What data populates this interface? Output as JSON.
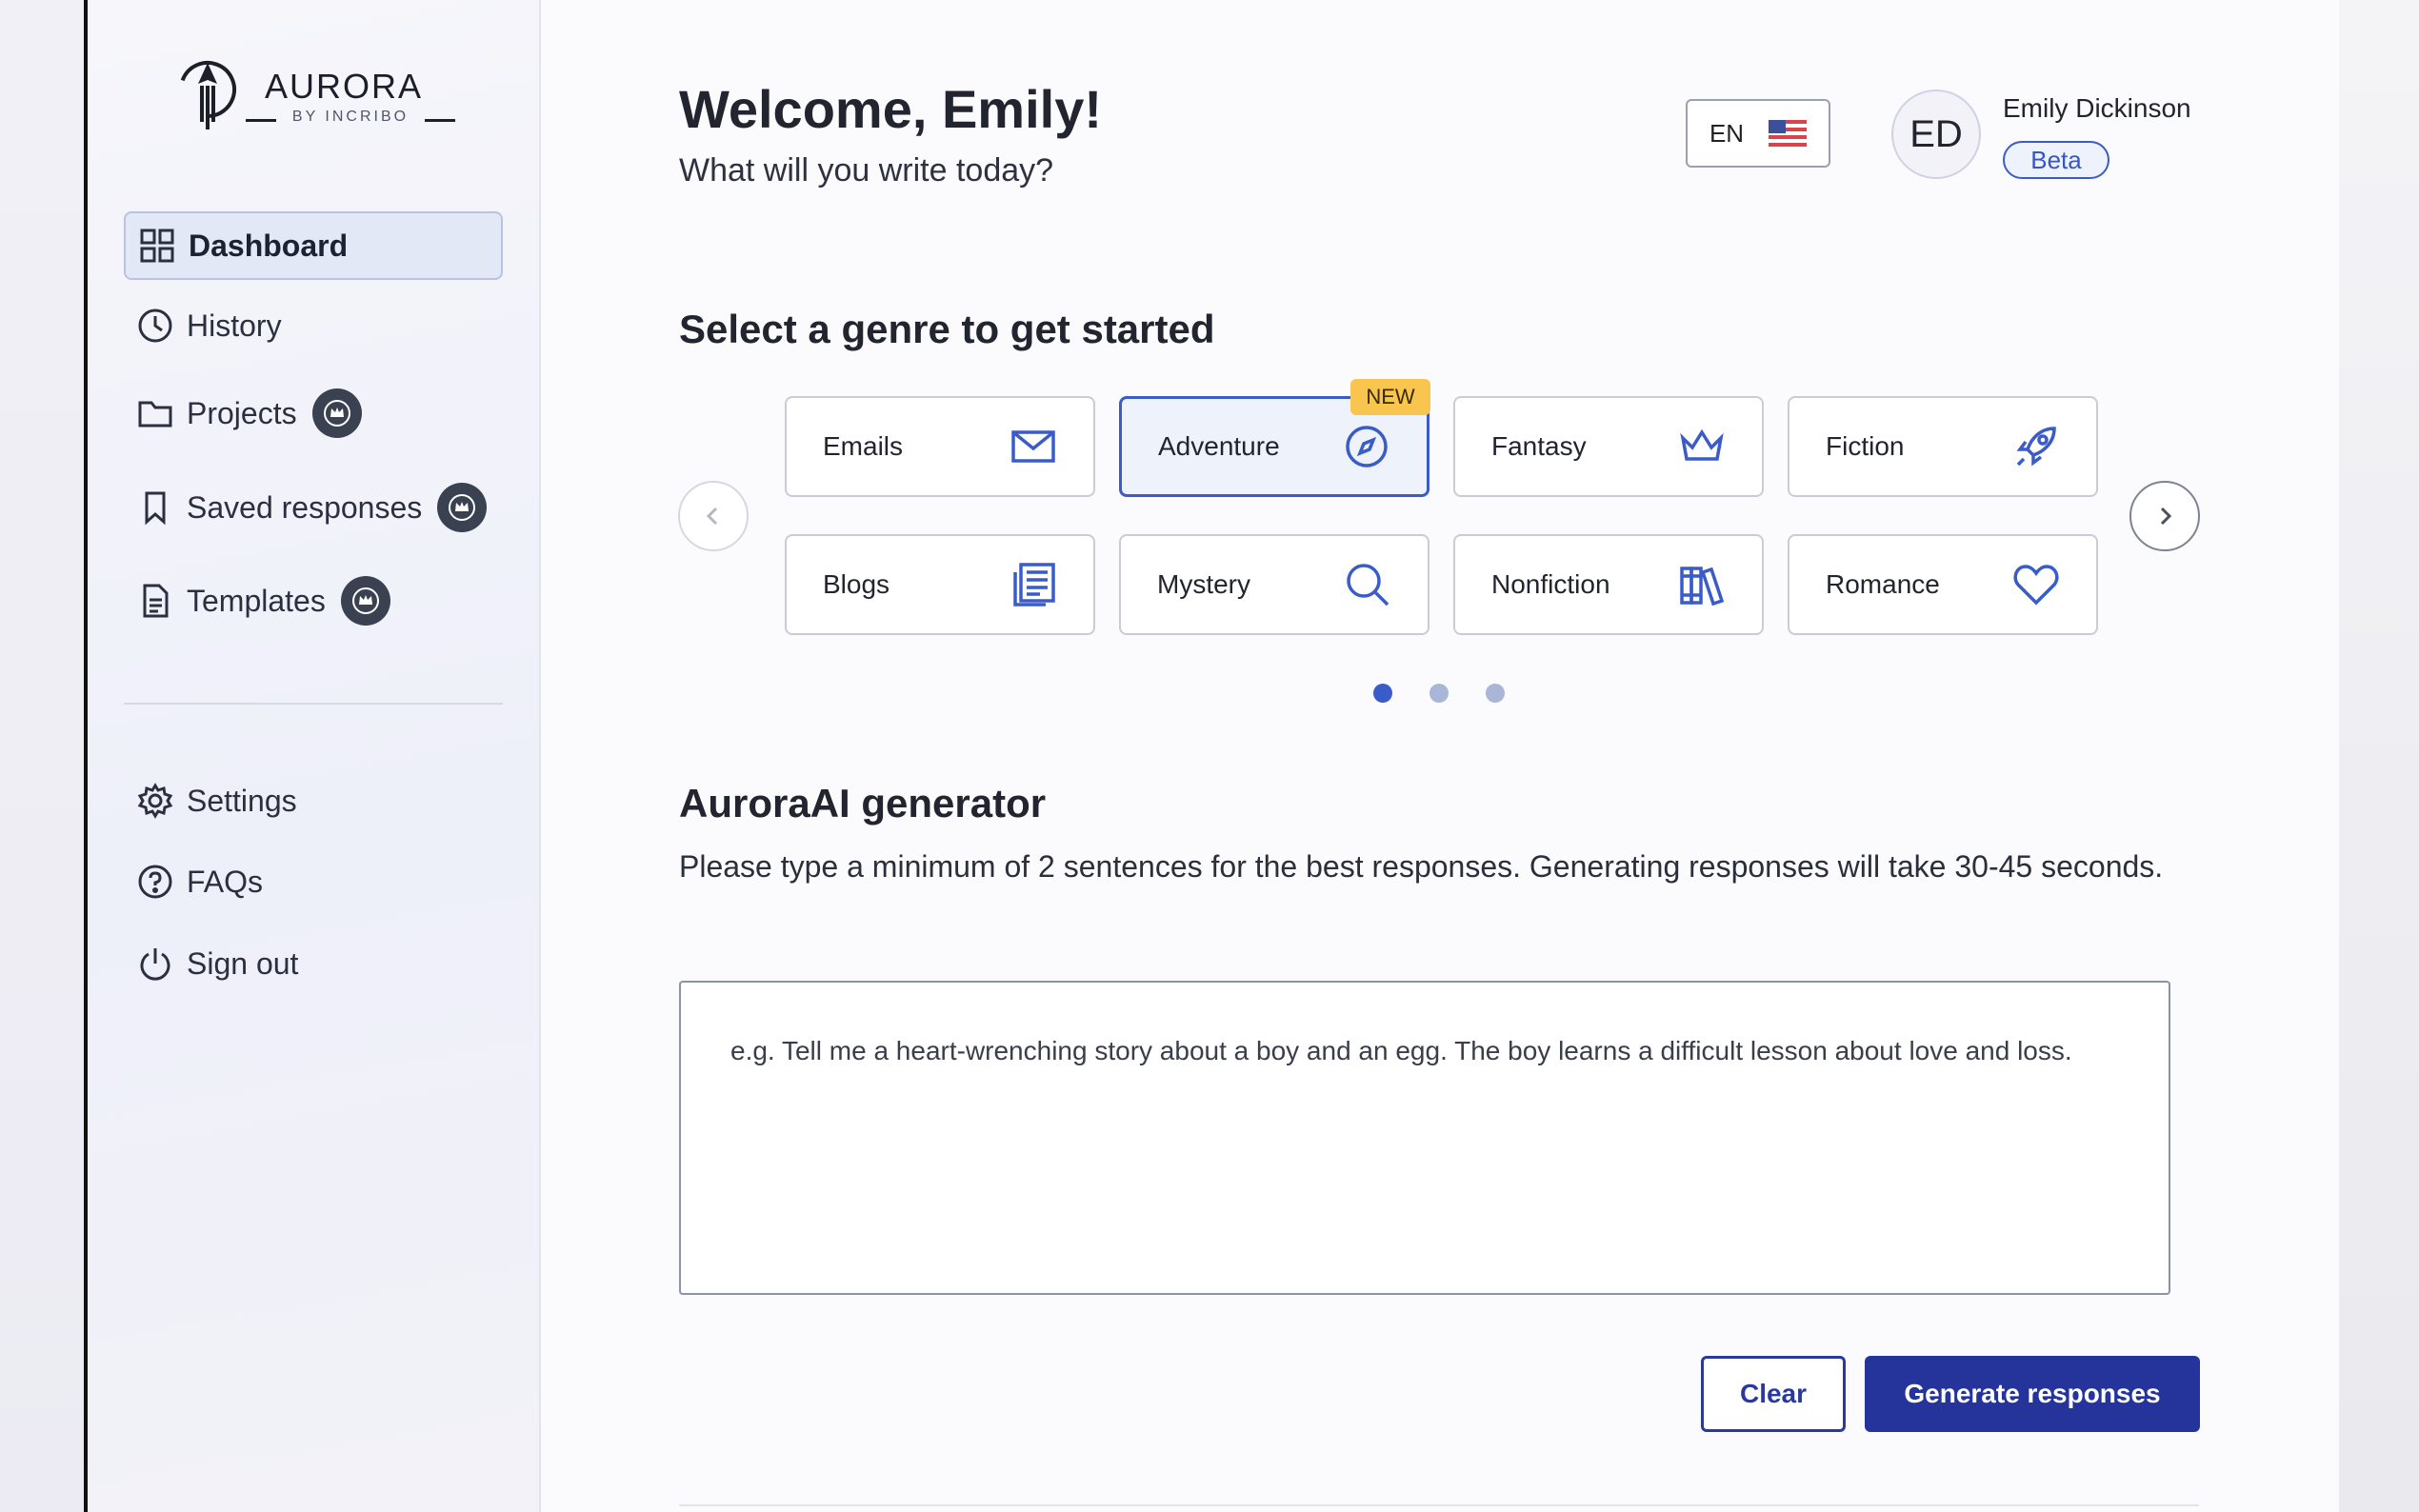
{
  "brand": {
    "name": "AURORA",
    "tagline": "BY INCRIBO"
  },
  "sidebar": {
    "items": [
      {
        "label": "Dashboard",
        "icon": "grid-icon",
        "active": true,
        "premium": false
      },
      {
        "label": "History",
        "icon": "clock-icon",
        "active": false,
        "premium": false
      },
      {
        "label": "Projects",
        "icon": "folder-icon",
        "active": false,
        "premium": true
      },
      {
        "label": "Saved responses",
        "icon": "bookmark-icon",
        "active": false,
        "premium": true
      },
      {
        "label": "Templates",
        "icon": "document-icon",
        "active": false,
        "premium": true
      }
    ],
    "bottom_items": [
      {
        "label": "Settings",
        "icon": "gear-icon"
      },
      {
        "label": "FAQs",
        "icon": "question-icon"
      },
      {
        "label": "Sign out",
        "icon": "power-icon"
      }
    ]
  },
  "header": {
    "welcome": "Welcome, Emily!",
    "subtitle": "What will you write today?",
    "language": "EN",
    "language_flag": "us-flag-icon",
    "avatar_initials": "ED",
    "user_name": "Emily Dickinson",
    "badge": "Beta"
  },
  "genres": {
    "title": "Select a genre to get started",
    "new_badge": "NEW",
    "items": [
      {
        "label": "Emails",
        "icon": "mail-icon",
        "selected": false,
        "new": true
      },
      {
        "label": "Adventure",
        "icon": "compass-icon",
        "selected": true,
        "new": false
      },
      {
        "label": "Fantasy",
        "icon": "crown-icon",
        "selected": false,
        "new": false
      },
      {
        "label": "Fiction",
        "icon": "rocket-icon",
        "selected": false,
        "new": false
      },
      {
        "label": "Blogs",
        "icon": "newspaper-icon",
        "selected": false,
        "new": false
      },
      {
        "label": "Mystery",
        "icon": "magnifier-icon",
        "selected": false,
        "new": false
      },
      {
        "label": "Nonfiction",
        "icon": "books-icon",
        "selected": false,
        "new": false
      },
      {
        "label": "Romance",
        "icon": "heart-icon",
        "selected": false,
        "new": false
      }
    ],
    "pages": 3,
    "current_page": 1
  },
  "generator": {
    "title": "AuroraAI generator",
    "description": "Please type a minimum of 2 sentences for the best responses. Generating responses will take 30-45 seconds.",
    "placeholder": "e.g. Tell me a heart-wrenching story about a boy and an egg. The boy learns a difficult lesson about love and loss.",
    "value": "",
    "clear_label": "Clear",
    "generate_label": "Generate responses"
  },
  "colors": {
    "accent": "#3a5cc8",
    "primary_button": "#25349a",
    "new_badge": "#f8c54e"
  }
}
